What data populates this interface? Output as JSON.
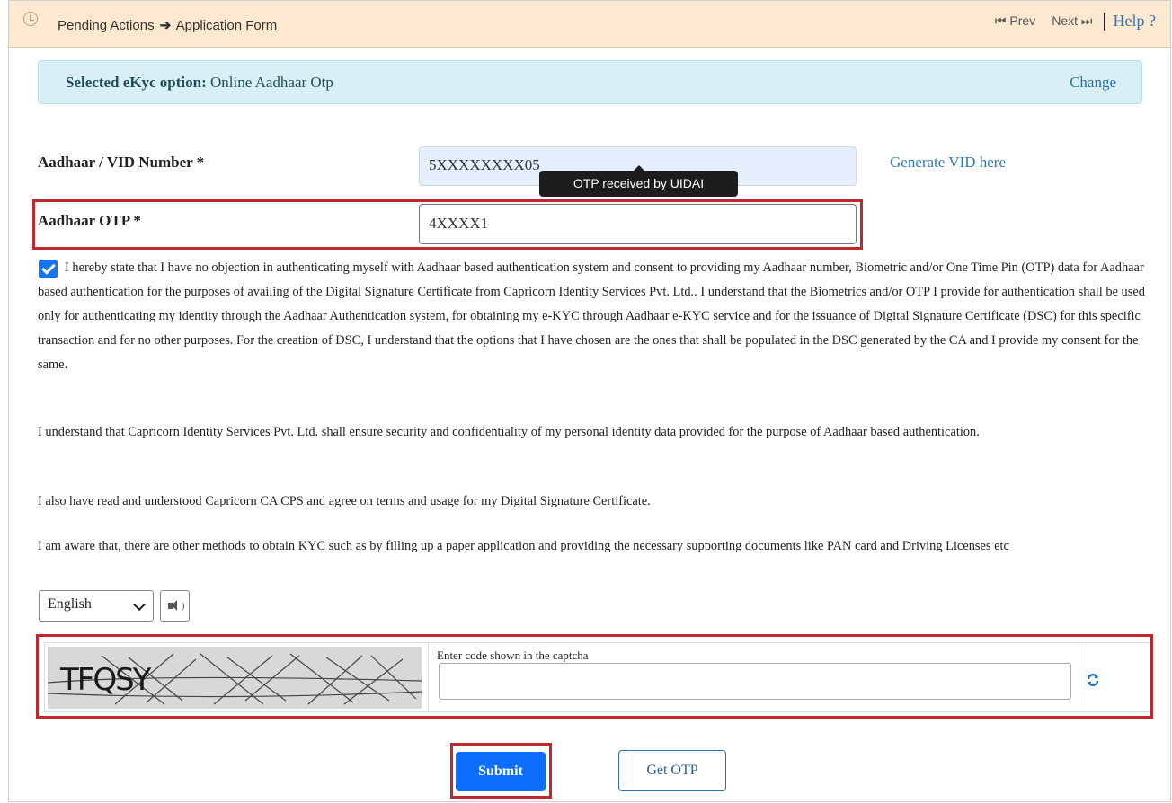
{
  "header": {
    "breadcrumb_parent": "Pending Actions",
    "breadcrumb_arrow": "➔",
    "breadcrumb_current": "Application Form",
    "prev_label": "Prev",
    "next_label": "Next",
    "help_label": "Help ?"
  },
  "ekyc": {
    "label_bold": "Selected eKyc option:",
    "value": "Online Aadhaar Otp",
    "change_label": "Change"
  },
  "form": {
    "aadhaar_label": "Aadhaar / VID Number *",
    "aadhaar_value": "5XXXXXXXX05",
    "generate_vid_label": "Generate VID here",
    "tooltip": "OTP received by UIDAI",
    "otp_label": "Aadhaar OTP *",
    "otp_value": "4XXXX1"
  },
  "consent": {
    "checked": true,
    "paragraphs": [
      "I hereby state that I have no objection in authenticating myself with Aadhaar based authentication system and consent to providing my Aadhaar number, Biometric and/or One Time Pin (OTP) data for Aadhaar based authentication for the purposes of availing of the Digital Signature Certificate from Capricorn Identity Services Pvt. Ltd.. I understand that the Biometrics and/or OTP I provide for authentication shall be used only for authenticating my identity through the Aadhaar Authentication system, for obtaining my e-KYC through Aadhaar e-KYC service and for the issuance of Digital Signature Certificate (DSC) for this specific transaction and for no other purposes. For the creation of DSC, I understand that the options that I have chosen are the ones that shall be populated in the DSC generated by the CA and I provide my consent for the same.",
      "I understand that Capricorn Identity Services Pvt. Ltd. shall ensure security and confidentiality of my personal identity data provided for the purpose of Aadhaar based authentication.",
      "I also have read and understood Capricorn CA CPS and agree on terms and usage for my Digital Signature Certificate.",
      "I am aware that, there are other methods to obtain KYC such as by filling up a paper application and providing the necessary supporting documents like PAN card and Driving Licenses etc"
    ]
  },
  "language": {
    "selected": "English"
  },
  "captcha": {
    "code_text": "TFQSY",
    "input_label": "Enter code shown in the captcha",
    "input_value": ""
  },
  "buttons": {
    "submit_label": "Submit",
    "get_otp_label": "Get OTP"
  },
  "colors": {
    "header_bg": "#fde9cf",
    "alert_bg": "#d8f0f5",
    "primary": "#0d6efd",
    "highlight_red": "#c0282d"
  },
  "icons": [
    "history-icon",
    "double-left-arrow-icon",
    "double-right-arrow-icon",
    "checkbox-checked-icon",
    "chevron-down-icon",
    "speaker-icon",
    "refresh-icon"
  ]
}
